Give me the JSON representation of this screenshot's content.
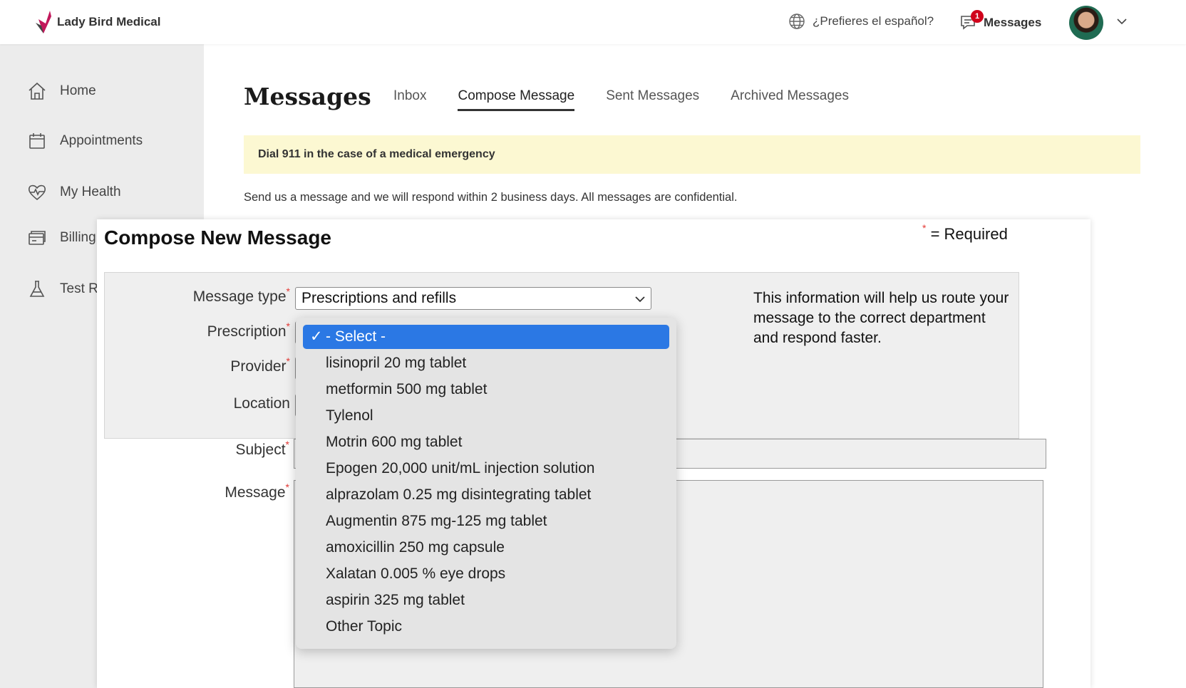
{
  "header": {
    "brand": "Lady Bird Medical",
    "language_link": "¿Prefieres el español?",
    "messages_label": "Messages",
    "messages_badge": "1"
  },
  "sidebar": {
    "items": [
      {
        "label": "Home",
        "icon": "home-icon"
      },
      {
        "label": "Appointments",
        "icon": "calendar-icon"
      },
      {
        "label": "My Health",
        "icon": "heart-icon"
      },
      {
        "label": "Billing",
        "icon": "billing-icon"
      },
      {
        "label": "Test Results",
        "icon": "flask-icon"
      }
    ]
  },
  "page": {
    "title": "Messages",
    "tabs": [
      {
        "label": "Inbox",
        "active": false
      },
      {
        "label": "Compose Message",
        "active": true
      },
      {
        "label": "Sent Messages",
        "active": false
      },
      {
        "label": "Archived Messages",
        "active": false
      }
    ],
    "alert": "Dial 911 in the case of a medical emergency",
    "intro": "Send us a message and we will respond within 2 business days. All messages are confidential."
  },
  "compose": {
    "title": "Compose New Message",
    "required_note": "= Required",
    "labels": {
      "message_type": "Message type",
      "prescription": "Prescription",
      "provider": "Provider",
      "location": "Location",
      "subject": "Subject",
      "message": "Message"
    },
    "message_type_value": "Prescriptions and refills",
    "help_text": "This information will help us route your message to the correct department and respond faster."
  },
  "dropdown": {
    "options": [
      "- Select -",
      "lisinopril 20 mg tablet",
      "metformin 500 mg tablet",
      "Tylenol",
      "Motrin 600 mg tablet",
      "Epogen 20,000 unit/mL injection solution",
      "alprazolam 0.25 mg disintegrating tablet",
      "Augmentin 875 mg-125 mg tablet",
      "amoxicillin 250 mg capsule",
      "Xalatan 0.005 % eye drops",
      "aspirin 325 mg tablet",
      "Other Topic"
    ],
    "selected_index": 0
  },
  "colors": {
    "accent_selected": "#2b78e4",
    "alert_bg": "#fcf8d2",
    "required_star": "#e53935",
    "badge": "#d0021b"
  }
}
